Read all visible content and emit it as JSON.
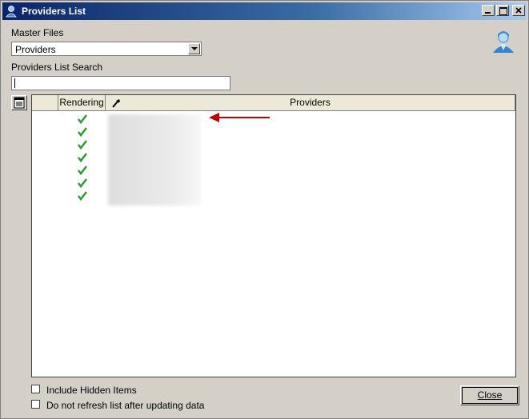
{
  "window": {
    "title": "Providers List"
  },
  "master_files": {
    "label": "Master Files",
    "selected": "Providers"
  },
  "search": {
    "label": "Providers List Search",
    "value": ""
  },
  "grid": {
    "columns": [
      "",
      "Rendering",
      "Providers"
    ],
    "rendering_checks": 7
  },
  "options": {
    "include_hidden": {
      "label": "Include Hidden Items",
      "checked": false
    },
    "no_refresh": {
      "label": "Do not refresh list after updating data",
      "checked": false
    }
  },
  "buttons": {
    "close_label": "Close"
  },
  "colors": {
    "title_bar": "#0a246a",
    "check": "#1f9e2a",
    "arrow": "#c00000"
  }
}
